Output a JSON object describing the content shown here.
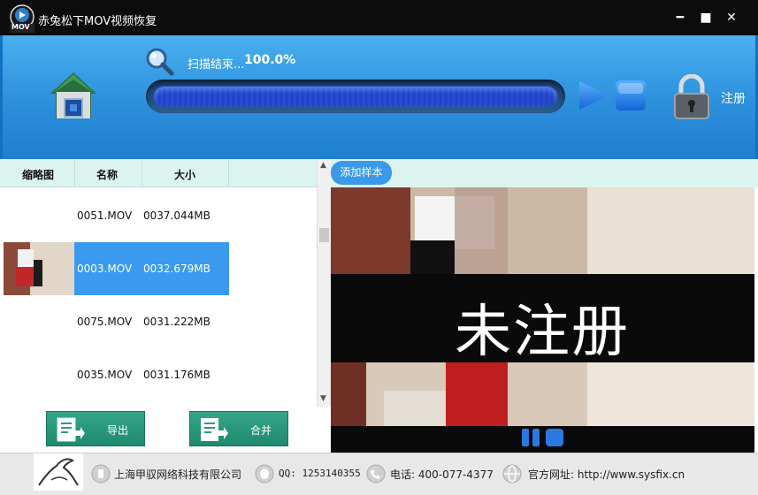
{
  "window": {
    "title": "赤兔松下MOV视频恢复",
    "logo_badge": "MOV",
    "minimize_glyph": "━",
    "maximize_glyph": "■",
    "close_glyph": "✕"
  },
  "header": {
    "scan_status": "扫描结束...",
    "scan_percent": "100.0%",
    "progress": 1.0,
    "register_label": "注册",
    "icons": [
      "home-icon",
      "search-icon",
      "play-icon",
      "stop-icon",
      "lock-icon"
    ]
  },
  "table": {
    "columns": [
      "缩略图",
      "名称",
      "大小"
    ],
    "rows": [
      {
        "name": "0051.MOV",
        "size": "0037.044MB",
        "selected": false
      },
      {
        "name": "0003.MOV",
        "size": "0032.679MB",
        "selected": true
      },
      {
        "name": "0075.MOV",
        "size": "0031.222MB",
        "selected": false
      },
      {
        "name": "0035.MOV",
        "size": "0031.176MB",
        "selected": false
      }
    ]
  },
  "actions": {
    "export_label": "导出",
    "merge_label": "合并"
  },
  "preview": {
    "add_sample_label": "添加样本",
    "watermark": "未注册"
  },
  "footer": {
    "company": "上海甲驭网络科技有限公司",
    "qq": "QQ: 1253140355",
    "phone": "电话: 400-077-4377",
    "website": "官方网址: http://www.sysfix.cn"
  },
  "colors": {
    "header_blue": "#2c8fdc",
    "selection_blue": "#3a9af0",
    "button_green": "#2a9a7c",
    "table_header": "#dcf4f0"
  }
}
